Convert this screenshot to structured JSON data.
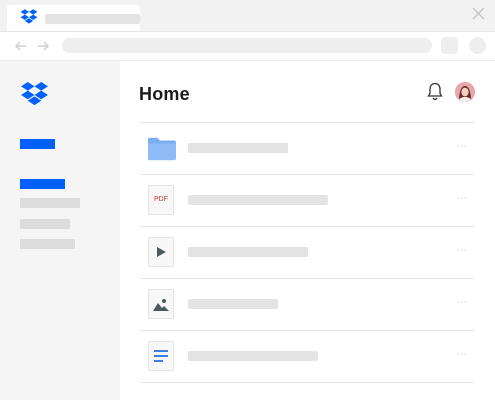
{
  "browser": {
    "icons": {
      "favicon": "dropbox-logo-icon",
      "close": "close-icon",
      "back": "back-arrow-icon",
      "forward": "forward-arrow-icon"
    }
  },
  "app": {
    "brand_color": "#0061fe",
    "sidebar": {
      "logo": "dropbox-logo-icon",
      "items": [
        {
          "state": "active"
        },
        {
          "state": "active"
        },
        {
          "state": "muted"
        },
        {
          "state": "muted"
        },
        {
          "state": "muted"
        }
      ]
    },
    "header": {
      "title": "Home",
      "icons": {
        "notifications": "bell-icon",
        "avatar": "avatar"
      }
    },
    "files": [
      {
        "type": "folder",
        "icon": "folder-icon",
        "more": "···"
      },
      {
        "type": "pdf",
        "icon": "pdf-file-icon",
        "badge": "PDF",
        "more": "···"
      },
      {
        "type": "video",
        "icon": "video-file-icon",
        "more": "···"
      },
      {
        "type": "image",
        "icon": "image-file-icon",
        "more": "···"
      },
      {
        "type": "document",
        "icon": "document-file-icon",
        "more": "···"
      }
    ]
  }
}
